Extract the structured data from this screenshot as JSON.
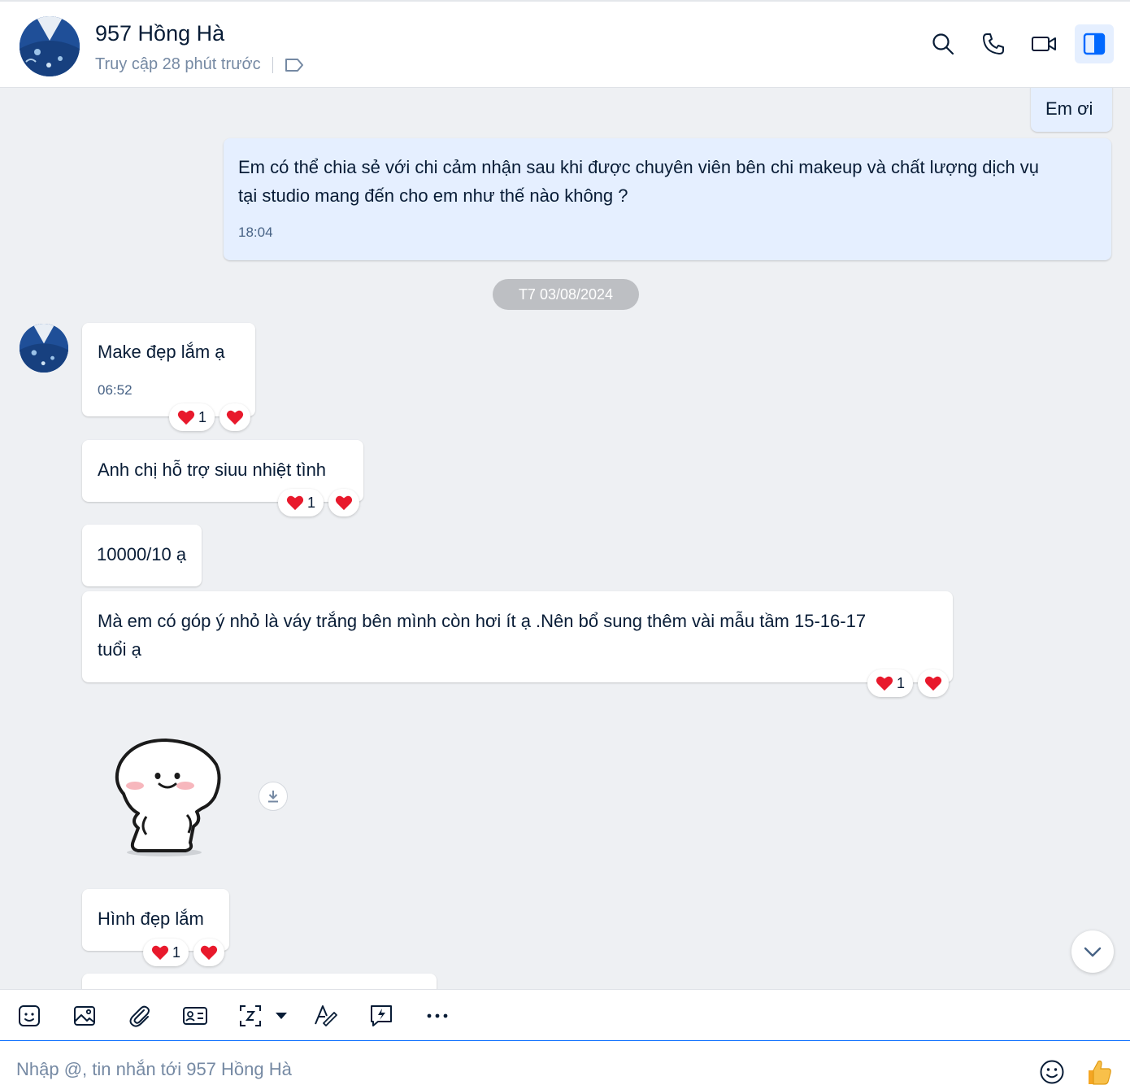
{
  "header": {
    "name": "957 Hồng Hà",
    "status": "Truy cập 28 phút trước"
  },
  "messages": {
    "sent_1": "Em ơi",
    "sent_2_line1": "Em có thể chia sẻ với chi cảm nhận sau khi được chuyên viên bên chi makeup và chất lượng dịch vụ",
    "sent_2_line2": "tại studio mang đến cho em như thế nào không ?",
    "sent_2_time": "18:04",
    "date_divider": "T7 03/08/2024",
    "recv_1": "Make  đẹp lắm ạ",
    "recv_1_time": "06:52",
    "recv_1_reaction_count": "1",
    "recv_2": "Anh chị hỗ trợ siuu nhiệt tình",
    "recv_2_reaction_count": "1",
    "recv_3": "10000/10 ạ",
    "recv_4_line1": "Mà em có  góp ý nhỏ  là váy trắng bên mình còn hơi ít ạ .Nên bổ sung thêm vài mẫu tầm 15-16-17",
    "recv_4_line2": "tuổi ạ",
    "recv_4_reaction_count": "1",
    "recv_5": "Hình đẹp lắm",
    "recv_5_reaction_count": "1"
  },
  "composer": {
    "placeholder": "Nhập @, tin nhắn tới 957 Hồng Hà"
  },
  "icons": {
    "header": [
      "search-icon",
      "phone-icon",
      "video-icon",
      "sidebar-toggle-icon"
    ],
    "toolbar": [
      "sticker-icon",
      "image-icon",
      "attachment-icon",
      "contact-card-icon",
      "screenshot-icon",
      "format-text-icon",
      "quick-message-icon",
      "more-icon"
    ],
    "composer": [
      "emoji-icon",
      "thumbs-up-icon"
    ]
  },
  "colors": {
    "accent": "#0068ff",
    "mine_bubble": "#e5efff",
    "chat_background": "#eef0f3",
    "reaction_heart": "#e8192c"
  }
}
